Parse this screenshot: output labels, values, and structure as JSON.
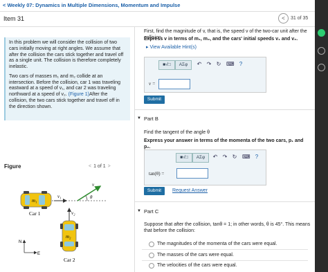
{
  "header": {
    "back_label": "< Weekly 07: Dynamics in Multiple Dimensions, Momentum and Impulse",
    "item_title": "Item 31",
    "page_indicator": "31 of 35",
    "prev_glyph": "<"
  },
  "intro": {
    "p1": "In this problem we will consider the collision of two cars initially moving at right angles. We assume that after the collision the cars stick together and travel off as a single unit. The collision is therefore completely inelastic.",
    "p2a": "Two cars of masses m₁ and m₂ collide at an intersection. Before the collision, car 1 was traveling eastward at a speed of v₁, and car 2 was traveling northward at a speed of v₂.",
    "p2_link": "(Figure 1)",
    "p2b": "After the collision, the two cars stick together and travel off in the direction shown."
  },
  "figure": {
    "title": "Figure",
    "nav_text": "1 of 1",
    "car1_label": "Car 1",
    "car2_label": "Car 2",
    "m1_label": "m₁",
    "m2_label": "m₂",
    "v_label": "v",
    "v1_label": "v₁",
    "v2_label": "v₂",
    "theta_label": "θ",
    "compass_n": "N",
    "compass_e": "E"
  },
  "partA": {
    "question": "First, find the magnitude of v, that is, the speed v of the two-car unit after the collision.",
    "instruction": "Express v in terms of m₁, m₂, and the cars' initial speeds v₁ and v₂.",
    "hints_link": "▸ View Available Hint(s)",
    "toolbar_templates": "■√□",
    "toolbar_greek": "AΣφ",
    "help": "?",
    "input_label": "v =",
    "input_value": "",
    "submit": "Submit"
  },
  "partB": {
    "header": "Part B",
    "question": "Find the tangent of the angle θ",
    "instruction": "Express your answer in terms of the momenta of the two cars, p₁ and p₂.",
    "toolbar_templates": "■√□",
    "toolbar_greek": "AΣφ",
    "help": "?",
    "input_label": "tan(θ) =",
    "input_value": "",
    "submit": "Submit",
    "request_answer": "Request Answer"
  },
  "partC": {
    "header": "Part C",
    "question": "Suppose that after the collision, tanθ = 1; in other words, θ is 45°. This means that before the collision:",
    "options": [
      "The magnitudes of the momenta of the cars were equal.",
      "The masses of the cars were equal.",
      "The velocities of the cars were equal."
    ]
  },
  "colors": {
    "accent": "#1a5fa8",
    "submit": "#1f6ea3",
    "intro_bg": "#e8f3f8",
    "car1": "#f1c40f",
    "car2": "#f1c40f",
    "car_window": "#8ec9df",
    "arrow": "#2e8b2e"
  }
}
